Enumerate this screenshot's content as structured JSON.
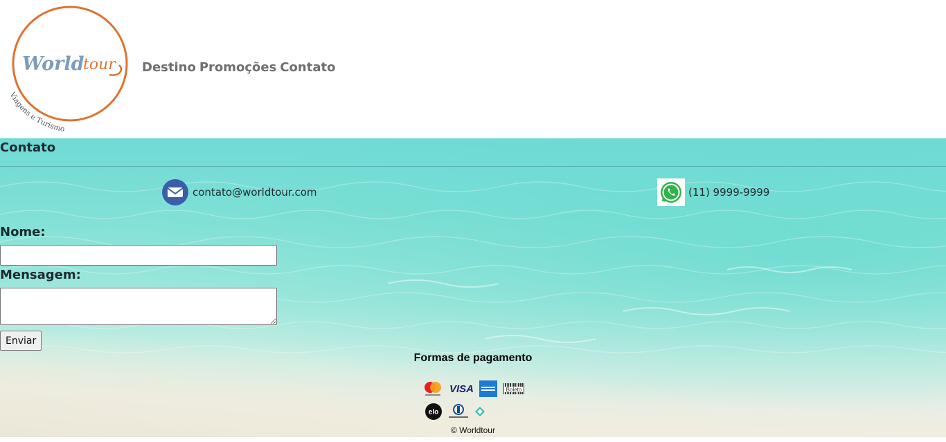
{
  "brand": {
    "logo_main": "Worldtour",
    "logo_sub": "Viagens e Turismo",
    "accent_color": "#e0712f",
    "logo_text_color": "#7b9dbb"
  },
  "nav": {
    "items": [
      "Destino",
      "Promoções",
      "Contato"
    ]
  },
  "contact": {
    "section_title": "Contato",
    "email": "contato@worldtour.com",
    "email_icon": "envelope-icon",
    "phone": "(11) 9999-9999",
    "phone_icon": "whatsapp-icon"
  },
  "form": {
    "name_label": "Nome:",
    "name_value": "",
    "message_label": "Mensagem:",
    "message_value": "",
    "submit_label": "Enviar"
  },
  "payment": {
    "title": "Formas de pagamento",
    "methods": [
      "mastercard-icon",
      "visa-icon",
      "amex-icon",
      "boleto-icon",
      "elo-icon",
      "diners-club-icon",
      "pix-icon"
    ],
    "visa_text": "VISA",
    "boleto_text": "Boleto",
    "elo_text": "elo"
  },
  "footer": {
    "copyright": "© Worldtour"
  }
}
